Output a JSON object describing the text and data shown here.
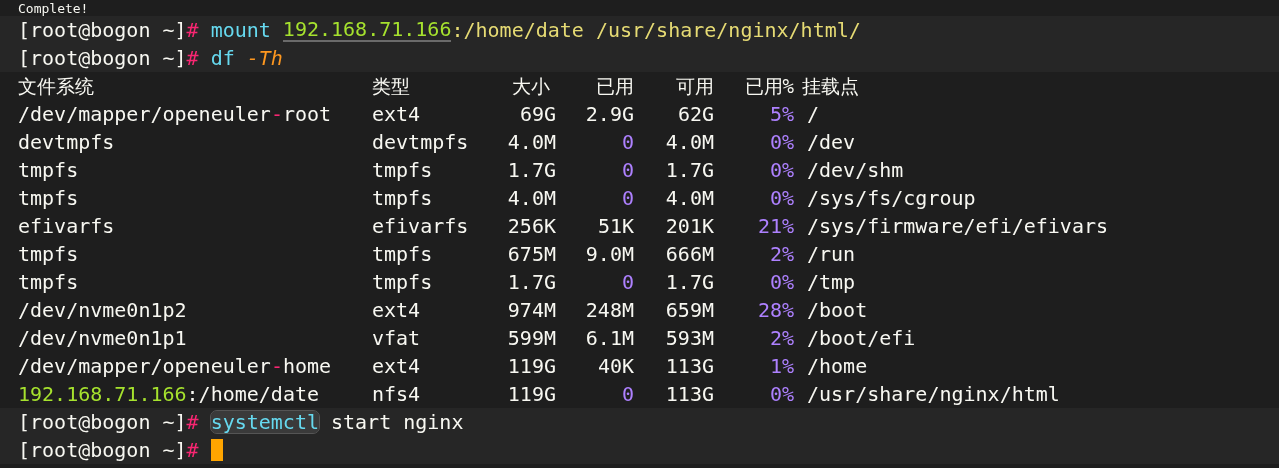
{
  "terminal": {
    "lines": [
      {
        "kind": "output",
        "text": "Complete!"
      },
      {
        "kind": "prompt",
        "prompt": "[root@bogon ~]",
        "symbol": "#",
        "tokens": [
          {
            "kind": "command",
            "text": "mount"
          },
          {
            "kind": "address",
            "text": "192.168.71.166",
            "underlined": true
          },
          {
            "kind": "path",
            "text": ":/home/date /usr/share/nginx/html/"
          }
        ]
      },
      {
        "kind": "prompt",
        "prompt": "[root@bogon ~]",
        "symbol": "#",
        "tokens": [
          {
            "kind": "command",
            "text": "df"
          },
          {
            "kind": "option",
            "text": "-Th"
          }
        ]
      },
      {
        "kind": "table",
        "columns": [
          "文件系统",
          "类型",
          "大小",
          "已用",
          "可用",
          "已用%",
          "挂载点"
        ],
        "rows": [
          {
            "filesystem": [
              {
                "kind": "plain",
                "text": "/dev/mapper/openeuler"
              },
              {
                "kind": "dash",
                "text": "-"
              },
              {
                "kind": "plain",
                "text": "root"
              }
            ],
            "fstype": "ext4",
            "size": "69G",
            "used": {
              "text": "2.9G",
              "kind": "size"
            },
            "avail": "62G",
            "use": "5%",
            "mount": "/"
          },
          {
            "filesystem": [
              {
                "kind": "plain",
                "text": "devtmpfs"
              }
            ],
            "fstype": "devtmpfs",
            "size": "4.0M",
            "used": {
              "text": "0",
              "kind": "number"
            },
            "avail": "4.0M",
            "use": "0%",
            "mount": "/dev"
          },
          {
            "filesystem": [
              {
                "kind": "plain",
                "text": "tmpfs"
              }
            ],
            "fstype": "tmpfs",
            "size": "1.7G",
            "used": {
              "text": "0",
              "kind": "number"
            },
            "avail": "1.7G",
            "use": "0%",
            "mount": "/dev/shm"
          },
          {
            "filesystem": [
              {
                "kind": "plain",
                "text": "tmpfs"
              }
            ],
            "fstype": "tmpfs",
            "size": "4.0M",
            "used": {
              "text": "0",
              "kind": "number"
            },
            "avail": "4.0M",
            "use": "0%",
            "mount": "/sys/fs/cgroup"
          },
          {
            "filesystem": [
              {
                "kind": "plain",
                "text": "efivarfs"
              }
            ],
            "fstype": "efivarfs",
            "size": "256K",
            "used": {
              "text": "51K",
              "kind": "size"
            },
            "avail": "201K",
            "use": "21%",
            "mount": "/sys/firmware/efi/efivars"
          },
          {
            "filesystem": [
              {
                "kind": "plain",
                "text": "tmpfs"
              }
            ],
            "fstype": "tmpfs",
            "size": "675M",
            "used": {
              "text": "9.0M",
              "kind": "size"
            },
            "avail": "666M",
            "use": "2%",
            "mount": "/run"
          },
          {
            "filesystem": [
              {
                "kind": "plain",
                "text": "tmpfs"
              }
            ],
            "fstype": "tmpfs",
            "size": "1.7G",
            "used": {
              "text": "0",
              "kind": "number"
            },
            "avail": "1.7G",
            "use": "0%",
            "mount": "/tmp"
          },
          {
            "filesystem": [
              {
                "kind": "plain",
                "text": "/dev/nvme0n1p2"
              }
            ],
            "fstype": "ext4",
            "size": "974M",
            "used": {
              "text": "248M",
              "kind": "size"
            },
            "avail": "659M",
            "use": "28%",
            "mount": "/boot"
          },
          {
            "filesystem": [
              {
                "kind": "plain",
                "text": "/dev/nvme0n1p1"
              }
            ],
            "fstype": "vfat",
            "size": "599M",
            "used": {
              "text": "6.1M",
              "kind": "size"
            },
            "avail": "593M",
            "use": "2%",
            "mount": "/boot/efi"
          },
          {
            "filesystem": [
              {
                "kind": "plain",
                "text": "/dev/mapper/openeuler"
              },
              {
                "kind": "dash",
                "text": "-"
              },
              {
                "kind": "plain",
                "text": "home"
              }
            ],
            "fstype": "ext4",
            "size": "119G",
            "used": {
              "text": "40K",
              "kind": "size"
            },
            "avail": "113G",
            "use": "1%",
            "mount": "/home"
          },
          {
            "filesystem": [
              {
                "kind": "address",
                "text": "192.168.71.166"
              },
              {
                "kind": "plain",
                "text": ":/home/date"
              }
            ],
            "fstype": "nfs4",
            "size": "119G",
            "used": {
              "text": "0",
              "kind": "number"
            },
            "avail": "113G",
            "use": "0%",
            "mount": "/usr/share/nginx/html"
          }
        ]
      },
      {
        "kind": "prompt",
        "prompt": "[root@bogon ~]",
        "symbol": "#",
        "tokens": [
          {
            "kind": "command",
            "text": "systemctl",
            "highlighted": true
          },
          {
            "kind": "plain",
            "text": "start nginx"
          }
        ]
      },
      {
        "kind": "prompt",
        "prompt": "[root@bogon ~]",
        "symbol": "#",
        "cursor": true
      }
    ]
  }
}
